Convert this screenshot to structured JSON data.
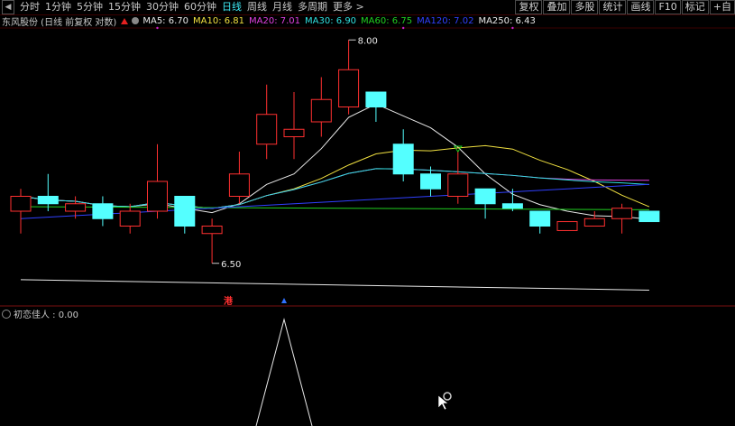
{
  "toolbar": {
    "periods": [
      "分时",
      "1分钟",
      "5分钟",
      "15分钟",
      "30分钟",
      "60分钟",
      "日线",
      "周线",
      "月线",
      "多周期",
      "更多 >"
    ],
    "active_period": "日线",
    "right_buttons": [
      "复权",
      "叠加",
      "多股",
      "统计",
      "画线",
      "F10",
      "标记",
      "+自"
    ]
  },
  "legend": {
    "title": "东风股份 (日线 前复权 对数)",
    "ma": [
      {
        "label": "MA5: 6.70",
        "color": "#e8e8e8"
      },
      {
        "label": "MA10: 6.81",
        "color": "#f0e040"
      },
      {
        "label": "MA20: 7.01",
        "color": "#e040e0"
      },
      {
        "label": "MA30: 6.90",
        "color": "#30e0e0"
      },
      {
        "label": "MA60: 6.75",
        "color": "#20d020"
      },
      {
        "label": "MA120: 7.02",
        "color": "#3040ff"
      },
      {
        "label": "MA250: 6.43",
        "color": "#e8e8e8"
      }
    ]
  },
  "annotations": {
    "high_label": "8.00",
    "low_label": "6.50",
    "hk_marker": "港"
  },
  "indicator": {
    "label": "初恋佳人 : 0.00"
  },
  "chart_data": {
    "type": "candlestick",
    "candles": [
      {
        "o": 6.85,
        "h": 7.0,
        "l": 6.7,
        "c": 6.95,
        "up": true
      },
      {
        "o": 6.95,
        "h": 7.1,
        "l": 6.85,
        "c": 6.9,
        "up": false
      },
      {
        "o": 6.85,
        "h": 6.95,
        "l": 6.8,
        "c": 6.9,
        "up": true
      },
      {
        "o": 6.9,
        "h": 6.95,
        "l": 6.75,
        "c": 6.8,
        "up": false
      },
      {
        "o": 6.75,
        "h": 6.9,
        "l": 6.7,
        "c": 6.85,
        "up": true
      },
      {
        "o": 6.85,
        "h": 7.3,
        "l": 6.8,
        "c": 7.05,
        "up": true
      },
      {
        "o": 6.95,
        "h": 6.95,
        "l": 6.7,
        "c": 6.75,
        "up": false
      },
      {
        "o": 6.7,
        "h": 6.8,
        "l": 6.5,
        "c": 6.75,
        "up": true
      },
      {
        "o": 6.95,
        "h": 7.25,
        "l": 6.9,
        "c": 7.1,
        "up": true
      },
      {
        "o": 7.3,
        "h": 7.7,
        "l": 7.2,
        "c": 7.5,
        "up": true
      },
      {
        "o": 7.35,
        "h": 7.65,
        "l": 7.2,
        "c": 7.4,
        "up": true
      },
      {
        "o": 7.45,
        "h": 7.75,
        "l": 7.35,
        "c": 7.6,
        "up": true
      },
      {
        "o": 7.55,
        "h": 8.0,
        "l": 7.5,
        "c": 7.8,
        "up": true
      },
      {
        "o": 7.65,
        "h": 7.65,
        "l": 7.45,
        "c": 7.55,
        "up": false
      },
      {
        "o": 7.3,
        "h": 7.4,
        "l": 7.05,
        "c": 7.1,
        "up": false
      },
      {
        "o": 7.1,
        "h": 7.15,
        "l": 6.95,
        "c": 7.0,
        "up": false
      },
      {
        "o": 7.1,
        "h": 7.25,
        "l": 6.9,
        "c": 6.95,
        "up": true
      },
      {
        "o": 7.0,
        "h": 7.0,
        "l": 6.8,
        "c": 6.9,
        "up": false
      },
      {
        "o": 6.9,
        "h": 7.0,
        "l": 6.85,
        "c": 6.87,
        "up": false
      },
      {
        "o": 6.85,
        "h": 6.85,
        "l": 6.7,
        "c": 6.75,
        "up": false
      },
      {
        "o": 6.72,
        "h": 6.78,
        "l": 6.72,
        "c": 6.78,
        "up": true
      },
      {
        "o": 6.75,
        "h": 6.85,
        "l": 6.75,
        "c": 6.8,
        "up": true
      },
      {
        "o": 6.8,
        "h": 6.9,
        "l": 6.7,
        "c": 6.87,
        "up": true
      },
      {
        "o": 6.85,
        "h": 6.85,
        "l": 6.78,
        "c": 6.78,
        "up": false
      }
    ]
  }
}
